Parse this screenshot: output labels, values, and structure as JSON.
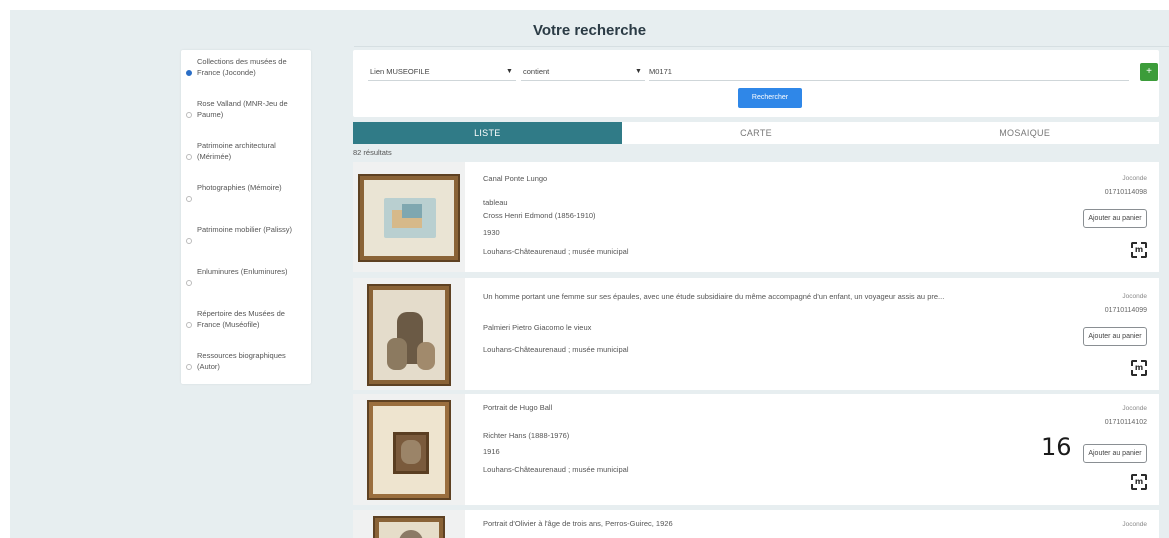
{
  "header": {
    "title": "Votre recherche"
  },
  "sidebar": {
    "items": [
      {
        "label": "Collections des musées de France (Joconde)",
        "checked": true
      },
      {
        "label": "Rose Valland (MNR-Jeu de Paume)",
        "checked": false
      },
      {
        "label": "Patrimoine architectural (Mérimée)",
        "checked": false
      },
      {
        "label": "Photographies (Mémoire)",
        "checked": false
      },
      {
        "label": "Patrimoine mobilier (Palissy)",
        "checked": false
      },
      {
        "label": "Enluminures (Enluminures)",
        "checked": false
      },
      {
        "label": "Répertoire des Musées de France (Muséofile)",
        "checked": false
      },
      {
        "label": "Ressources biographiques (Autor)",
        "checked": false
      }
    ]
  },
  "search": {
    "field": "Lien MUSEOFILE",
    "operator": "contient",
    "value": "M0171",
    "add_label": "+",
    "submit_label": "Rechercher"
  },
  "tabs": [
    {
      "label": "LISTE",
      "active": true
    },
    {
      "label": "CARTE",
      "active": false
    },
    {
      "label": "MOSAIQUE",
      "active": false
    }
  ],
  "results_count": "82 résultats",
  "results": [
    {
      "title": "Canal Ponte Lungo",
      "lines": [
        "tableau",
        "Cross Henri Edmond (1856-1910)",
        "1930",
        "Louhans-Châteaurenaud ; musée municipal"
      ],
      "source": "Joconde",
      "ref": "01710114098",
      "cart_label": "Ajouter au panier"
    },
    {
      "title": "Un homme portant une femme sur ses épaules, avec une étude subsidiaire du même accompagné d'un enfant, un voyageur assis au pre...",
      "lines": [
        "Palmieri Pietro Giacomo le vieux",
        "Louhans-Châteaurenaud ; musée municipal"
      ],
      "source": "Joconde",
      "ref": "01710114099",
      "cart_label": "Ajouter au panier"
    },
    {
      "title": "Portrait de Hugo Ball",
      "lines": [
        "Richter Hans (1888-1976)",
        "1916",
        "Louhans-Châteaurenaud ; musée municipal"
      ],
      "source": "Joconde",
      "ref": "01710114102",
      "cart_label": "Ajouter au panier"
    },
    {
      "title": "Portrait d'Olivier à l'âge de trois ans, Perros-Guirec, 1926",
      "lines": [],
      "source": "Joconde",
      "ref": "",
      "cart_label": ""
    }
  ],
  "overlay_number": "16",
  "colors": {
    "accent": "#307b87",
    "button": "#2f87e8",
    "add": "#3c9c3a",
    "background": "#e7eef0"
  }
}
